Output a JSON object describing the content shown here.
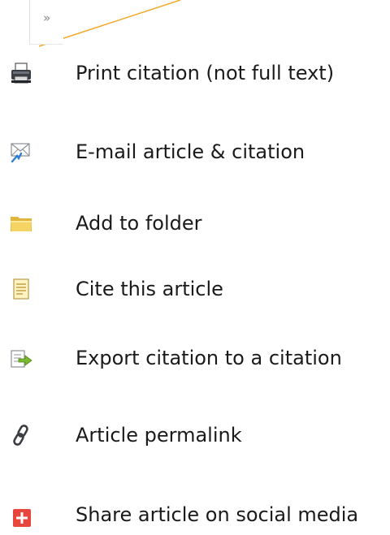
{
  "collapse_button": {
    "glyph": "»",
    "icon": "double-chevron-right-icon"
  },
  "callout_color": "#f0a92b",
  "tools": [
    {
      "label": "Print citation (not full text)",
      "icon": "printer-icon"
    },
    {
      "label": "E-mail article & citation",
      "icon": "email-envelope-icon"
    },
    {
      "label": "Add to folder",
      "icon": "folder-icon"
    },
    {
      "label": "Cite this article",
      "icon": "cite-document-icon"
    },
    {
      "label": "Export citation to a citation",
      "icon": "export-arrow-icon"
    },
    {
      "label": "Article permalink",
      "icon": "chain-link-icon"
    },
    {
      "label": "Share article on social media",
      "icon": "share-plus-icon"
    }
  ]
}
